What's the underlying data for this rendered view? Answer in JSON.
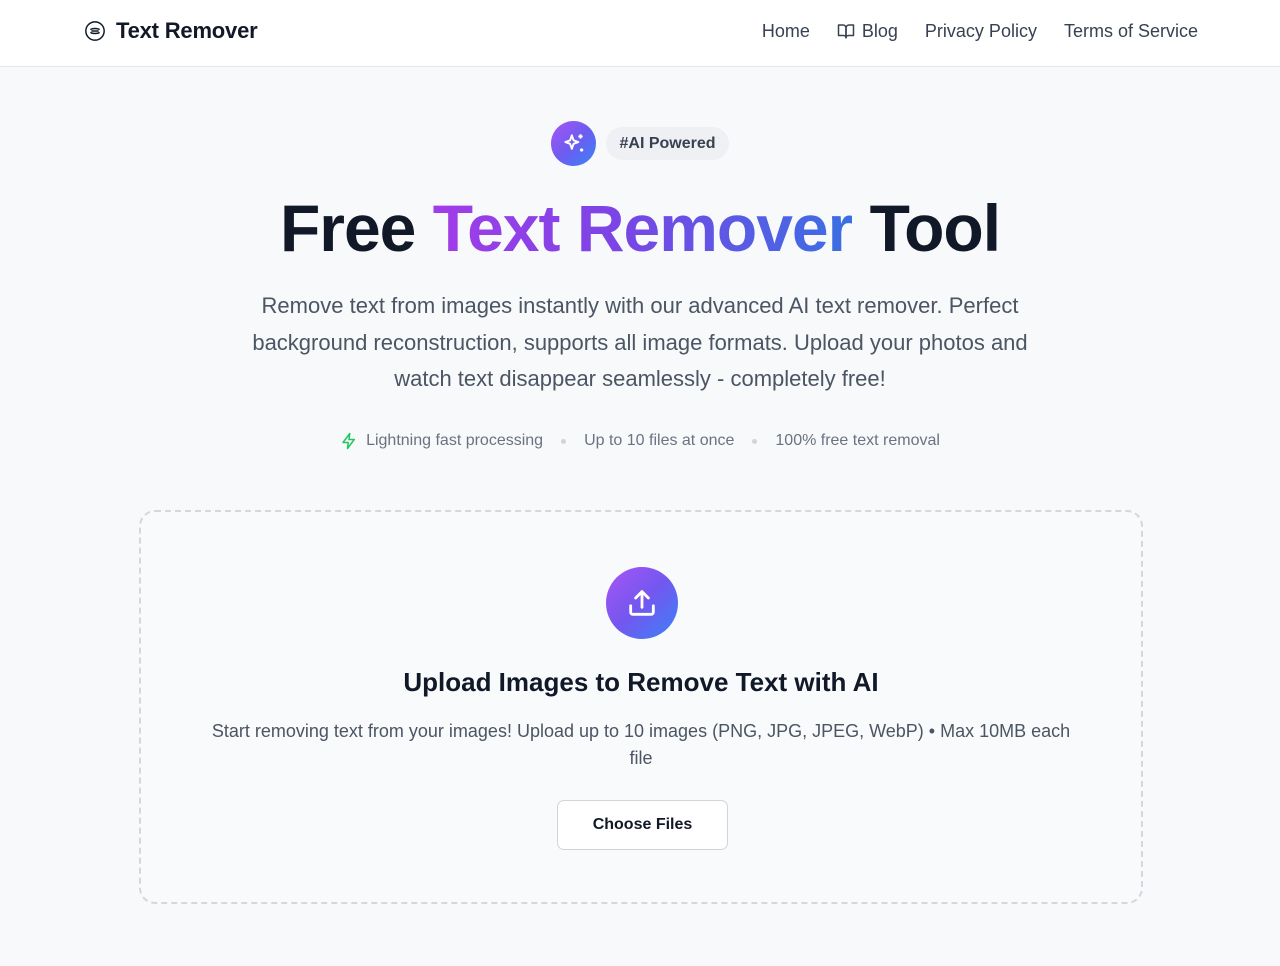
{
  "header": {
    "brand": "Text Remover",
    "nav": [
      {
        "label": "Home"
      },
      {
        "label": "Blog",
        "icon": "book-icon"
      },
      {
        "label": "Privacy Policy"
      },
      {
        "label": "Terms of Service"
      }
    ]
  },
  "hero": {
    "badge": "#AI Powered",
    "title_start": "Free ",
    "title_highlight": "Text Remover",
    "title_end": " Tool",
    "description": "Remove text from images instantly with our advanced AI text remover. Perfect background reconstruction, supports all image formats. Upload your photos and watch text disappear seamlessly - completely free!",
    "features": [
      "Lightning fast processing",
      "Up to 10 files at once",
      "100% free text removal"
    ]
  },
  "upload": {
    "title": "Upload Images to Remove Text with AI",
    "description": "Start removing text from your images! Upload up to 10 images (PNG, JPG, JPEG, WebP) • Max 10MB each file",
    "button_label": "Choose Files"
  },
  "colors": {
    "accent_purple": "#a855f7",
    "accent_blue": "#3b82f6",
    "bolt_green": "#22c55e"
  }
}
